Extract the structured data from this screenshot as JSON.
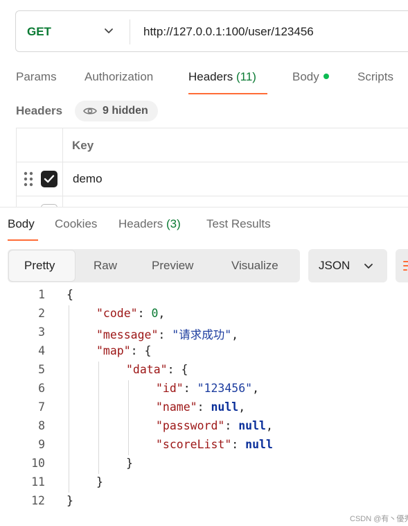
{
  "request": {
    "method": "GET",
    "url": "http://127.0.0.1:100/user/123456"
  },
  "request_tabs": [
    {
      "label": "Params"
    },
    {
      "label": "Authorization"
    },
    {
      "label": "Headers",
      "count": "(11)",
      "active": true
    },
    {
      "label": "Body",
      "has_content_dot": true
    },
    {
      "label": "Scripts"
    }
  ],
  "headers_section": {
    "title": "Headers",
    "hidden_label": "9 hidden",
    "column_key": "Key",
    "rows": [
      {
        "key": "demo",
        "checked": true
      }
    ]
  },
  "response_tabs": [
    {
      "label": "Body",
      "active": true
    },
    {
      "label": "Cookies"
    },
    {
      "label": "Headers",
      "count": "(3)"
    },
    {
      "label": "Test Results"
    }
  ],
  "view_modes": [
    "Pretty",
    "Raw",
    "Preview",
    "Visualize"
  ],
  "active_view_mode": "Pretty",
  "format": "JSON",
  "code_lines": [
    {
      "n": "1",
      "indent": 0,
      "tokens": [
        {
          "t": "{",
          "c": "punc"
        }
      ]
    },
    {
      "n": "2",
      "indent": 1,
      "tokens": [
        {
          "t": "\"code\"",
          "c": "key"
        },
        {
          "t": ": ",
          "c": "punc"
        },
        {
          "t": "0",
          "c": "num"
        },
        {
          "t": ",",
          "c": "punc"
        }
      ]
    },
    {
      "n": "3",
      "indent": 1,
      "tokens": [
        {
          "t": "\"message\"",
          "c": "key"
        },
        {
          "t": ": ",
          "c": "punc"
        },
        {
          "t": "\"请求成功\"",
          "c": "str"
        },
        {
          "t": ",",
          "c": "punc"
        }
      ]
    },
    {
      "n": "4",
      "indent": 1,
      "tokens": [
        {
          "t": "\"map\"",
          "c": "key"
        },
        {
          "t": ": {",
          "c": "punc"
        }
      ]
    },
    {
      "n": "5",
      "indent": 2,
      "tokens": [
        {
          "t": "\"data\"",
          "c": "key"
        },
        {
          "t": ": {",
          "c": "punc"
        }
      ]
    },
    {
      "n": "6",
      "indent": 3,
      "tokens": [
        {
          "t": "\"id\"",
          "c": "key"
        },
        {
          "t": ": ",
          "c": "punc"
        },
        {
          "t": "\"123456\"",
          "c": "str"
        },
        {
          "t": ",",
          "c": "punc"
        }
      ]
    },
    {
      "n": "7",
      "indent": 3,
      "tokens": [
        {
          "t": "\"name\"",
          "c": "key"
        },
        {
          "t": ": ",
          "c": "punc"
        },
        {
          "t": "null",
          "c": "null"
        },
        {
          "t": ",",
          "c": "punc"
        }
      ]
    },
    {
      "n": "8",
      "indent": 3,
      "tokens": [
        {
          "t": "\"password\"",
          "c": "key"
        },
        {
          "t": ": ",
          "c": "punc"
        },
        {
          "t": "null",
          "c": "null"
        },
        {
          "t": ",",
          "c": "punc"
        }
      ]
    },
    {
      "n": "9",
      "indent": 3,
      "tokens": [
        {
          "t": "\"scoreList\"",
          "c": "key"
        },
        {
          "t": ": ",
          "c": "punc"
        },
        {
          "t": "null",
          "c": "null"
        }
      ]
    },
    {
      "n": "10",
      "indent": 2,
      "tokens": [
        {
          "t": "}",
          "c": "punc"
        }
      ]
    },
    {
      "n": "11",
      "indent": 1,
      "tokens": [
        {
          "t": "}",
          "c": "punc"
        }
      ]
    },
    {
      "n": "12",
      "indent": 0,
      "tokens": [
        {
          "t": "}",
          "c": "punc"
        }
      ]
    }
  ],
  "watermark": "CSDN @有丶優秀",
  "colors": {
    "accent": "#ff6c37",
    "method_get": "#0a7a33",
    "json_key": "#9c1515",
    "json_string": "#1d3d9f",
    "json_number": "#0a7a33",
    "json_null": "#0a2f9a"
  }
}
